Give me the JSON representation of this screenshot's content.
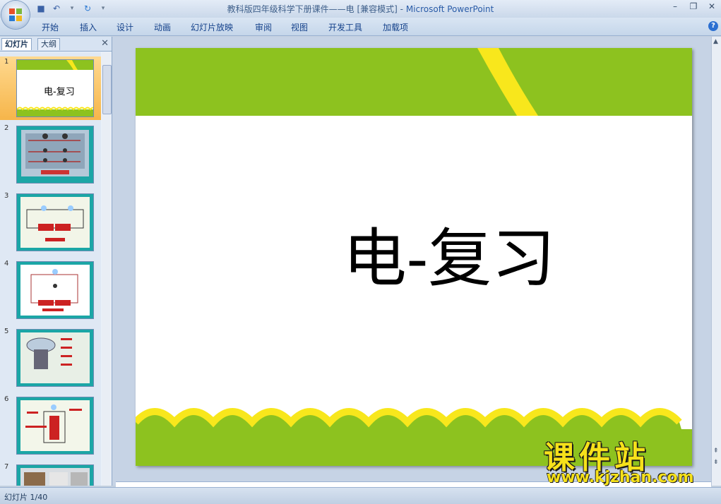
{
  "window": {
    "title_doc": "教科版四年级科学下册课件——电 [兼容模式]",
    "title_sep": " - ",
    "title_app": "Microsoft PowerPoint"
  },
  "ribbon": {
    "tabs": [
      "开始",
      "插入",
      "设计",
      "动画",
      "幻灯片放映",
      "审阅",
      "视图",
      "开发工具",
      "加载项"
    ]
  },
  "pane": {
    "tabs": [
      "幻灯片",
      "大纲"
    ]
  },
  "slides": [
    {
      "num": "1",
      "title": "电-复习",
      "selected": true
    },
    {
      "num": "2"
    },
    {
      "num": "3"
    },
    {
      "num": "4"
    },
    {
      "num": "5"
    },
    {
      "num": "6"
    },
    {
      "num": "7"
    }
  ],
  "current_slide": {
    "title": "电-复习"
  },
  "status": {
    "slide_indicator": "幻灯片 1/40"
  },
  "watermark": {
    "main": "课件站",
    "url": "www.kjzhan.com"
  },
  "colors": {
    "accent_green": "#8dc21f",
    "accent_yellow": "#f8e71c",
    "teal": "#1ba6a6"
  }
}
